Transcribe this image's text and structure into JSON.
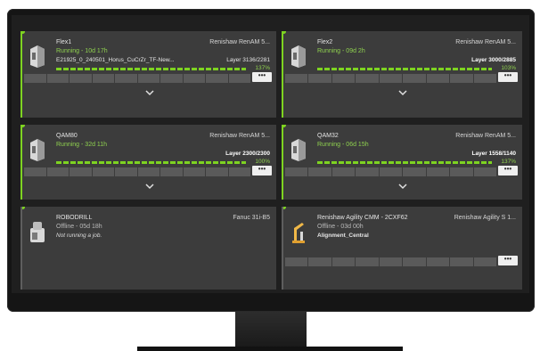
{
  "machines": [
    {
      "name": "Flex1",
      "model": "Renishaw RenAM 5...",
      "status": "Running - 10d 17h",
      "job": "E21925_0_240501_Horus_CuCrZr_TF-New...",
      "layer": "Layer 3136/2281",
      "percent": "137%",
      "progress": 1.0,
      "online": true,
      "has_chevron": true
    },
    {
      "name": "Flex2",
      "model": "Renishaw RenAM 5...",
      "status": "Running - 09d 2h",
      "job": "",
      "layer": "Layer 3000/2885",
      "percent": "103%",
      "progress": 1.0,
      "online": true,
      "has_chevron": true
    },
    {
      "name": "QAM80",
      "model": "Renishaw RenAM 5...",
      "status": "Running - 32d 11h",
      "job": "",
      "layer": "Layer 2300/2300",
      "percent": "100%",
      "progress": 1.0,
      "online": true,
      "has_chevron": true
    },
    {
      "name": "QAM32",
      "model": "Renishaw RenAM 5...",
      "status": "Running - 06d 15h",
      "job": "",
      "layer": "Layer 1558/1140",
      "percent": "137%",
      "progress": 1.0,
      "online": true,
      "has_chevron": true
    },
    {
      "name": "ROBODRILL",
      "model": "Fanuc 31i-B5",
      "status": "Offline - 05d 18h",
      "job": "Not running a job.",
      "layer": "",
      "percent": "",
      "progress": null,
      "online": false,
      "has_chevron": false
    },
    {
      "name": "Renishaw Agility CMM - 2CXF62",
      "model": "Renishaw Agility S 1...",
      "status": "Offline - 03d 00h",
      "job": "Alignment_Central",
      "layer": "",
      "percent": "",
      "progress": null,
      "online": false,
      "has_chevron": false
    }
  ],
  "more_label": "•••",
  "colors": {
    "running": "#7ed321",
    "offline": "#5e5e5e",
    "card": "#3c3c3c",
    "screen": "#1f1f1f"
  },
  "icons": {
    "printer": "3d-printer-icon",
    "cnc": "cnc-mill-icon",
    "arm": "cmm-arm-icon",
    "chevron": "chevron-down-icon"
  }
}
